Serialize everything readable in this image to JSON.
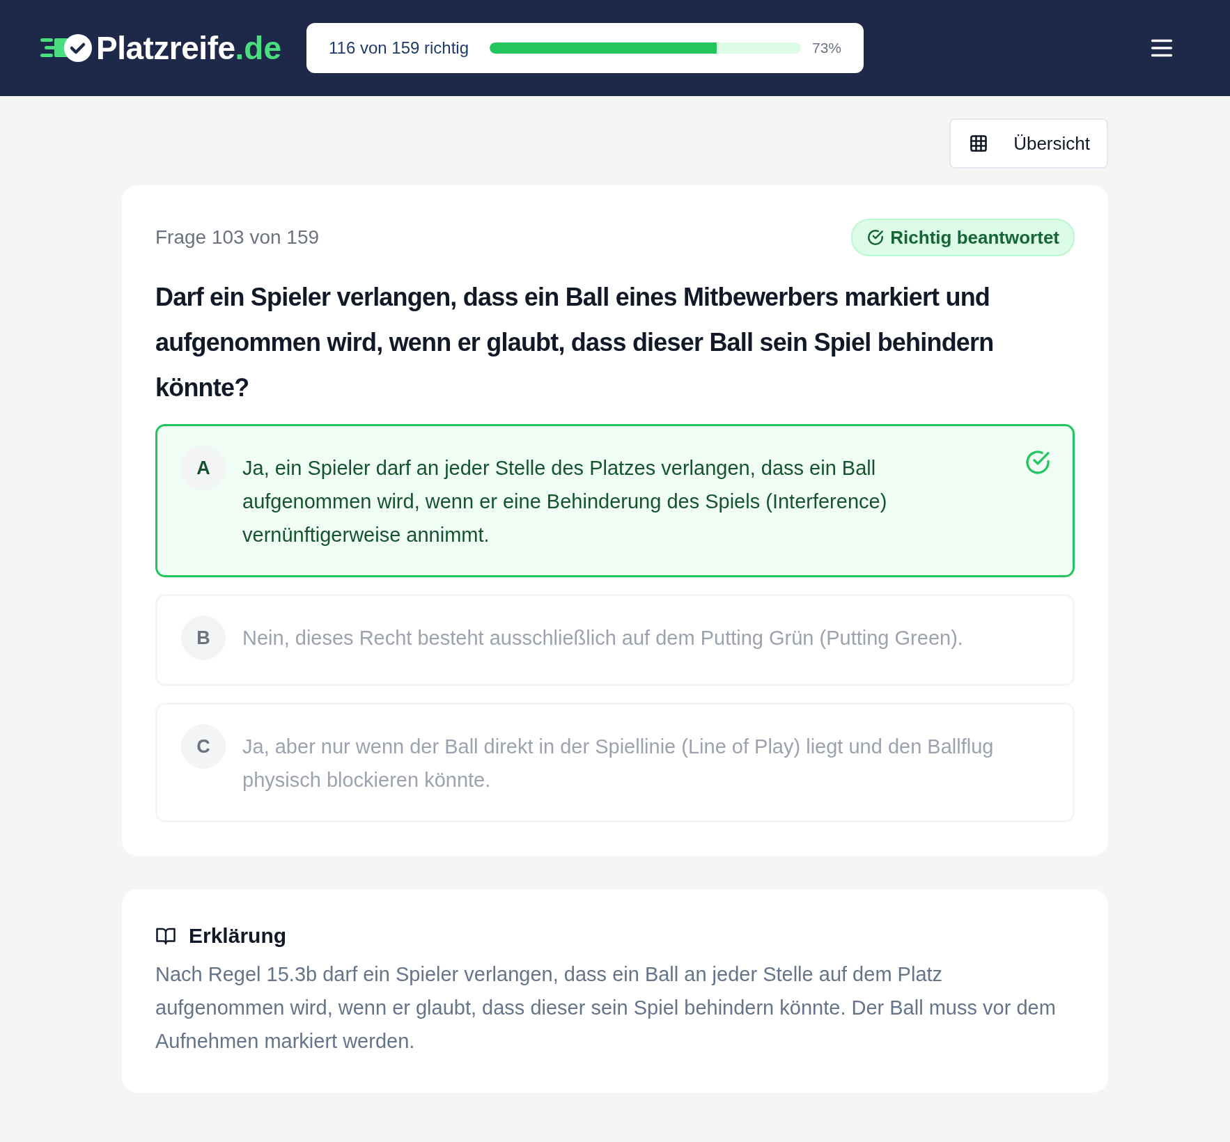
{
  "header": {
    "logo": {
      "name": "Platzreife",
      "suffix": ".de"
    },
    "progress": {
      "label": "116 von 159 richtig",
      "level": 0.73,
      "percent": "73%"
    }
  },
  "overview_button": {
    "label": "Übersicht"
  },
  "question": {
    "counter": "Frage 103 von 159",
    "status": "Richtig beantwortet",
    "answered_correctly": true,
    "text": "Darf ein Spieler verlangen, dass ein Ball eines Mitbewerbers markiert und aufgenommen wird, wenn er glaubt, dass dieser Ball sein Spiel behindern könnte?",
    "options": [
      {
        "letter": "A",
        "text": "Ja, ein Spieler darf an jeder Stelle des Platzes verlangen, dass ein Ball aufgenommen wird, wenn er eine Behinderung des Spiels (Interference) vernünftigerweise annimmt.",
        "correct": true
      },
      {
        "letter": "B",
        "text": "Nein, dieses Recht besteht ausschließlich auf dem Putting Grün (Putting Green).",
        "correct": false
      },
      {
        "letter": "C",
        "text": "Ja, aber nur wenn der Ball direkt in der Spiellinie (Line of Play) liegt und den Ballflug physisch blockieren könnte.",
        "correct": false
      }
    ]
  },
  "explanation": {
    "title": "Erklärung",
    "text": "Nach Regel 15.3b darf ein Spieler verlangen, dass ein Ball an jeder Stelle auf dem Platz aufgenommen wird, wenn er glaubt, dass dieser sein Spiel behindern könnte. Der Ball muss vor dem Aufnehmen markiert werden."
  }
}
